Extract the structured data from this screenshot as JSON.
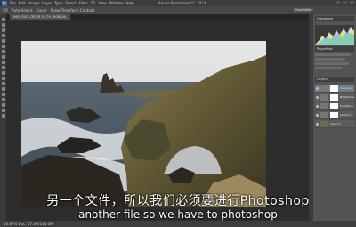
{
  "app": {
    "title": "Adobe Photoshop CC 2014",
    "menu": [
      "Ps",
      "File",
      "Edit",
      "Image",
      "Layer",
      "Type",
      "Select",
      "Filter",
      "3D",
      "View",
      "Window",
      "Help"
    ]
  },
  "options": {
    "items": [
      "Auto-Select:",
      "Layer",
      "Show Transform Controls"
    ],
    "workspace": "Essentials"
  },
  "document": {
    "tab_label": "IMG_0342.CR2 @ 16.7% (RGB/16)"
  },
  "statusbar": {
    "zoom_info": "16.67%   Doc: 57.0M/114.0M"
  },
  "panels": {
    "histogram_title": "Histogram",
    "properties_title": "Properties",
    "layers_title": "Layers",
    "layers": [
      {
        "name": "Curves 1",
        "selected": true
      },
      {
        "name": "Brightness",
        "selected": false
      },
      {
        "name": "Hue/Sat 1",
        "selected": false
      },
      {
        "name": "Levels 1",
        "selected": false
      },
      {
        "name": "Layer 0",
        "selected": false
      }
    ]
  },
  "subtitles": {
    "chinese": "另一个文件，所以我们必须要进行Photoshop",
    "english": "another file so we have to photoshop"
  }
}
